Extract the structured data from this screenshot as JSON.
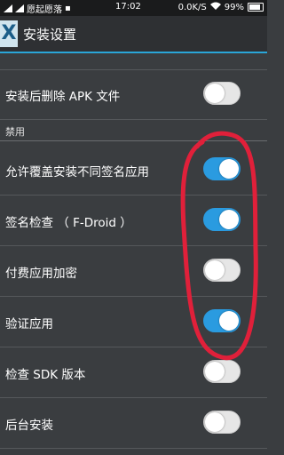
{
  "status_bar": {
    "carrier": "愿起愿落",
    "time": "17:02",
    "speed": "0.0K/S",
    "battery": "99%"
  },
  "action_bar": {
    "title": "安装设置",
    "app_icon_letter": "X"
  },
  "colors": {
    "accent": "#2aa6d8",
    "toggle_on": "#2a9be0",
    "annotation": "#e0203a"
  },
  "settings": {
    "delete_apk": {
      "label": "安装后删除 APK 文件",
      "enabled": false
    },
    "section_header": "禁用",
    "allow_overwrite": {
      "label": "允许覆盖安装不同签名应用",
      "enabled": true
    },
    "signature_check": {
      "label": "签名检查 （ F-Droid ）",
      "enabled": true
    },
    "paid_encrypt": {
      "label": "付费应用加密",
      "enabled": false
    },
    "verify_app": {
      "label": "验证应用",
      "enabled": true
    },
    "check_sdk": {
      "label": "检查 SDK 版本",
      "enabled": false
    },
    "background_install": {
      "label": "后台安装",
      "enabled": false
    }
  }
}
